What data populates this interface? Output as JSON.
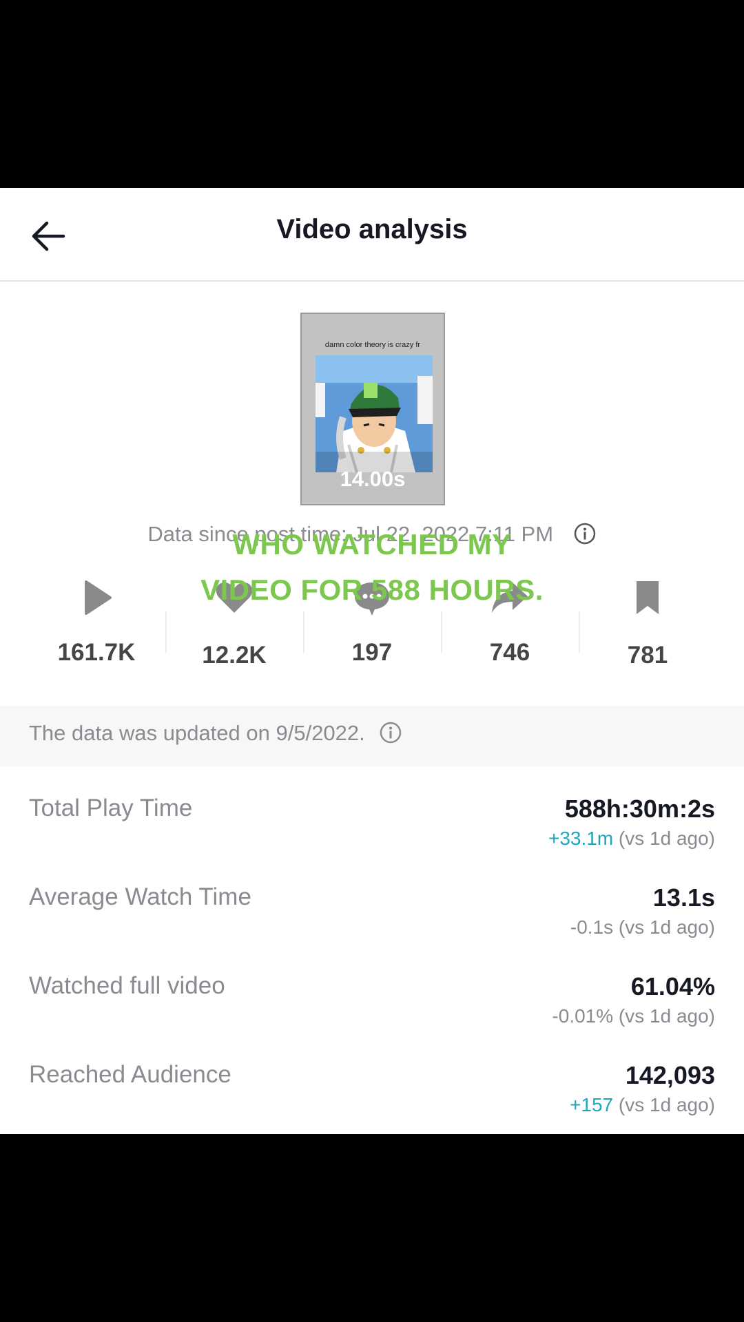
{
  "header": {
    "title": "Video analysis",
    "back_icon": "arrow-left-icon"
  },
  "thumbnail": {
    "caption": "damn color theory is crazy fr",
    "duration": "14.00s"
  },
  "since_text": "Data since post time: Jul 22, 2022 7:11 PM",
  "overlay": {
    "line1": "WHO WATCHED MY",
    "line2": "VIDEO FOR 588 HOURS.",
    "color": "#7cc74e"
  },
  "stats": [
    {
      "icon": "play-icon",
      "value": "161.7K"
    },
    {
      "icon": "heart-icon",
      "value": "12.2K"
    },
    {
      "icon": "comment-icon",
      "value": "197"
    },
    {
      "icon": "share-icon",
      "value": "746"
    },
    {
      "icon": "bookmark-icon",
      "value": "781"
    }
  ],
  "notice": {
    "text": "The data was updated on 9/5/2022."
  },
  "metrics": [
    {
      "label": "Total Play Time",
      "value": "588h:30m:2s",
      "change": "+33.1m",
      "change_type": "positive",
      "compare": "(vs 1d ago)"
    },
    {
      "label": "Average Watch Time",
      "value": "13.1s",
      "change": "-0.1s",
      "change_type": "negative",
      "compare": "(vs 1d ago)"
    },
    {
      "label": "Watched full video",
      "value": "61.04%",
      "change": "-0.01%",
      "change_type": "negative",
      "compare": "(vs 1d ago)"
    },
    {
      "label": "Reached Audience",
      "value": "142,093",
      "change": "+157",
      "change_type": "positive",
      "compare": "(vs 1d ago)"
    }
  ],
  "colors": {
    "positive": "#1fa6b8",
    "text_gray": "#8a8b91",
    "text_dark": "#161823"
  }
}
